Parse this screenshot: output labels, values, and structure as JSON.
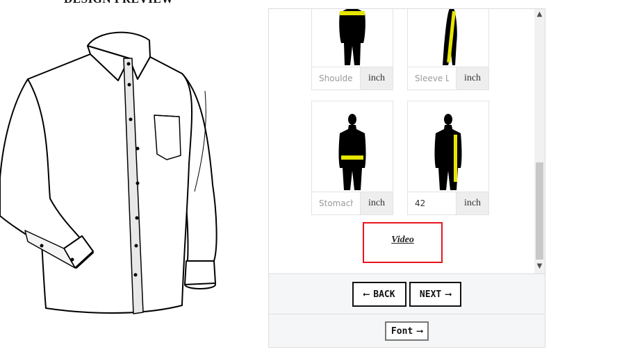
{
  "preview": {
    "title": "DESIGN PREVIEW"
  },
  "measurements": [
    {
      "name": "shoulder",
      "placeholder": "Shoulder",
      "value": "",
      "unit": "inch",
      "icon": "shoulder-measure-figure-icon"
    },
    {
      "name": "sleeve",
      "placeholder": "Sleeve Length",
      "value": "",
      "unit": "inch",
      "icon": "sleeve-measure-figure-icon"
    },
    {
      "name": "stomach",
      "placeholder": "Stomach",
      "value": "",
      "unit": "inch",
      "icon": "stomach-measure-figure-icon"
    },
    {
      "name": "length",
      "placeholder": "",
      "value": "42",
      "unit": "inch",
      "icon": "length-measure-figure-icon"
    }
  ],
  "video": {
    "label": "Video"
  },
  "nav": {
    "back_arrow": "⟵",
    "back_label": "BACK",
    "next_label": "NEXT",
    "next_arrow": "⟶"
  },
  "font_button": {
    "label": "Font",
    "arrow": "⟶"
  },
  "scrollbar": {
    "up": "▲",
    "down": "▼"
  },
  "colors": {
    "highlight": "#e8141c",
    "measure_line": "#e6e600",
    "panel_bg": "#f5f6f8"
  }
}
